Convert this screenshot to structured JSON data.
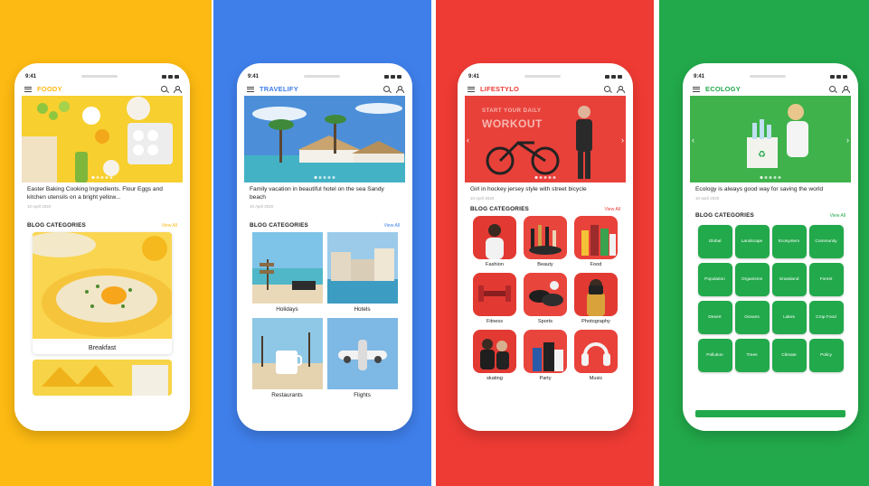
{
  "phones": [
    {
      "theme": "yellow",
      "accent": "#FDBA12",
      "status_time": "9:41",
      "brand": "FOODY",
      "hero_caption": "Easter Baking Cooking Ingredients. Flour Eggs and kitchen utensils on a bright yellow...",
      "hero_date": "10 April 2020",
      "section_title": "BLOG CATEGORIES",
      "view_all": "View All",
      "categories": [
        "Breakfast"
      ]
    },
    {
      "theme": "blue",
      "accent": "#3F7FEA",
      "status_time": "9:41",
      "brand": "TRAVELIFY",
      "hero_caption": "Family vacation in beautiful hotel on the sea Sandy beach",
      "hero_date": "10 April 2020",
      "section_title": "BLOG CATEGORIES",
      "view_all": "View All",
      "categories": [
        "Holidays",
        "Hotels",
        "Restaurants",
        "Flights"
      ]
    },
    {
      "theme": "red",
      "accent": "#EE3B34",
      "status_time": "9:41",
      "brand": "LIFESTYLO",
      "hero_overlay_line1": "START YOUR DAILY",
      "hero_overlay_line2": "WORKOUT",
      "hero_caption": "Girl in hockey jersey style with street bicycle",
      "hero_date": "10 April 2020",
      "section_title": "BLOG CATEGORIES",
      "view_all": "View All",
      "categories": [
        "Fashion",
        "Beauty",
        "Food",
        "Fitness",
        "Sports",
        "Photography",
        "skating",
        "Party",
        "Music"
      ]
    },
    {
      "theme": "green",
      "accent": "#22A94B",
      "status_time": "9:41",
      "brand": "ECOLOGY",
      "hero_caption": "Ecology is always good way for saving the world",
      "hero_date": "10 April 2020",
      "section_title": "BLOG CATEGORIES",
      "view_all": "View All",
      "categories": [
        "Global",
        "Landscape",
        "Ecosystem",
        "Community",
        "Population",
        "Organisms",
        "Grassland",
        "Forest",
        "Desert",
        "Oceans",
        "Lakes",
        "Crop Food",
        "Pollution",
        "Trees",
        "Climate",
        "Policy"
      ]
    }
  ]
}
